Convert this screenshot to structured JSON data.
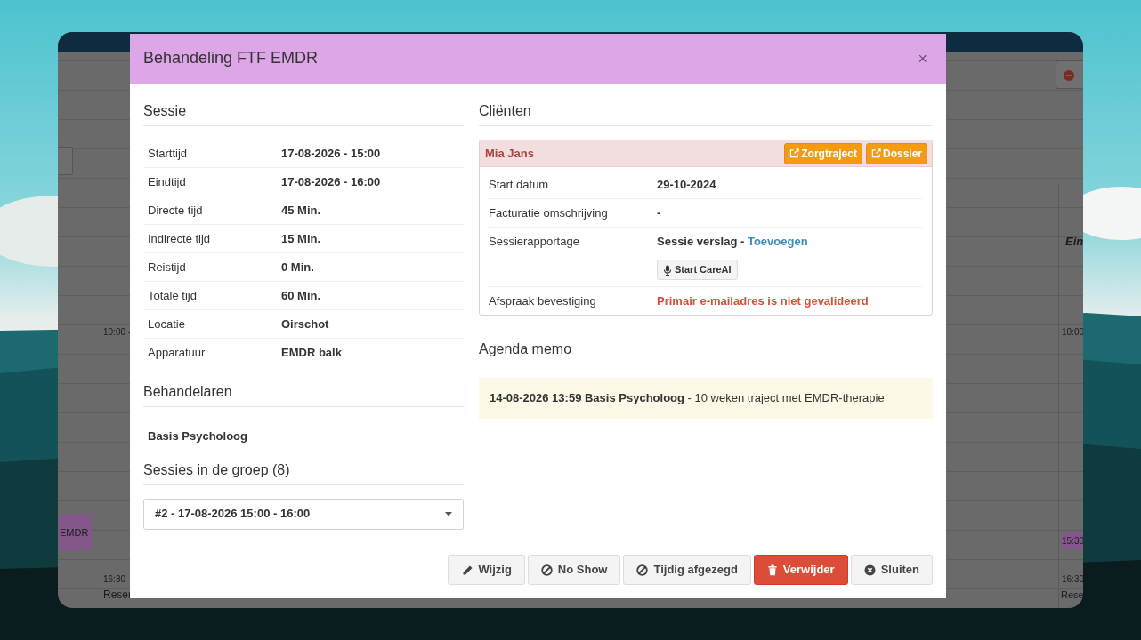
{
  "background_window": {
    "left_column": {
      "time_top": "10:00 -",
      "event": "EMDR",
      "time_bottom": "16:30 -",
      "event_bottom": "Reser"
    },
    "right_column": {
      "heading": "Ein",
      "time_top": "10:00",
      "event": "15:30",
      "time_bottom": "16:30",
      "event_bottom": "Rese"
    }
  },
  "modal": {
    "title": "Behandeling FTF EMDR",
    "close": "×",
    "session": {
      "heading": "Sessie",
      "rows": [
        {
          "label": "Starttijd",
          "value": "17-08-2026 - 15:00"
        },
        {
          "label": "Eindtijd",
          "value": "17-08-2026 - 16:00"
        },
        {
          "label": "Directe tijd",
          "value": "45 Min."
        },
        {
          "label": "Indirecte tijd",
          "value": "15 Min."
        },
        {
          "label": "Reistijd",
          "value": "0 Min."
        },
        {
          "label": "Totale tijd",
          "value": "60 Min."
        },
        {
          "label": "Locatie",
          "value": "Oirschot"
        },
        {
          "label": "Apparatuur",
          "value": "EMDR balk"
        }
      ]
    },
    "practitioners": {
      "heading": "Behandelaren",
      "names": [
        "Basis Psycholoog"
      ]
    },
    "group_sessions": {
      "heading": "Sessies in de groep (8)",
      "select_value": "#2 - 17-08-2026 15:00 - 16:00"
    },
    "clients": {
      "heading": "Cliënten",
      "client": {
        "name": "Mia Jans",
        "buttons": [
          "Zorgtraject",
          "Dossier"
        ],
        "rows": [
          {
            "kind": "text",
            "label": "Start datum",
            "value": "29-10-2024"
          },
          {
            "kind": "text",
            "label": "Facturatie omschrijving",
            "value": "-"
          },
          {
            "kind": "report",
            "label": "Sessierapportage",
            "value": "Sessie verslag",
            "separator": " - ",
            "link": "Toevoegen",
            "button": "Start CareAI"
          },
          {
            "kind": "warning",
            "label": "Afspraak bevestiging",
            "value": "Primair e-mailadres is niet gevalideerd"
          }
        ]
      }
    },
    "memo": {
      "heading": "Agenda memo",
      "text": "**14-08-2026 13:59 Basis Psycholoog** - 10 weken traject met EMDR-therapie"
    },
    "footer_buttons": [
      {
        "label": "Wijzig",
        "kind": "edit"
      },
      {
        "label": "No Show",
        "kind": "noshow"
      },
      {
        "label": "Tijdig afgezegd",
        "kind": "cancelled"
      },
      {
        "label": "Verwijder",
        "kind": "delete"
      },
      {
        "label": "Sluiten",
        "kind": "close"
      }
    ]
  }
}
